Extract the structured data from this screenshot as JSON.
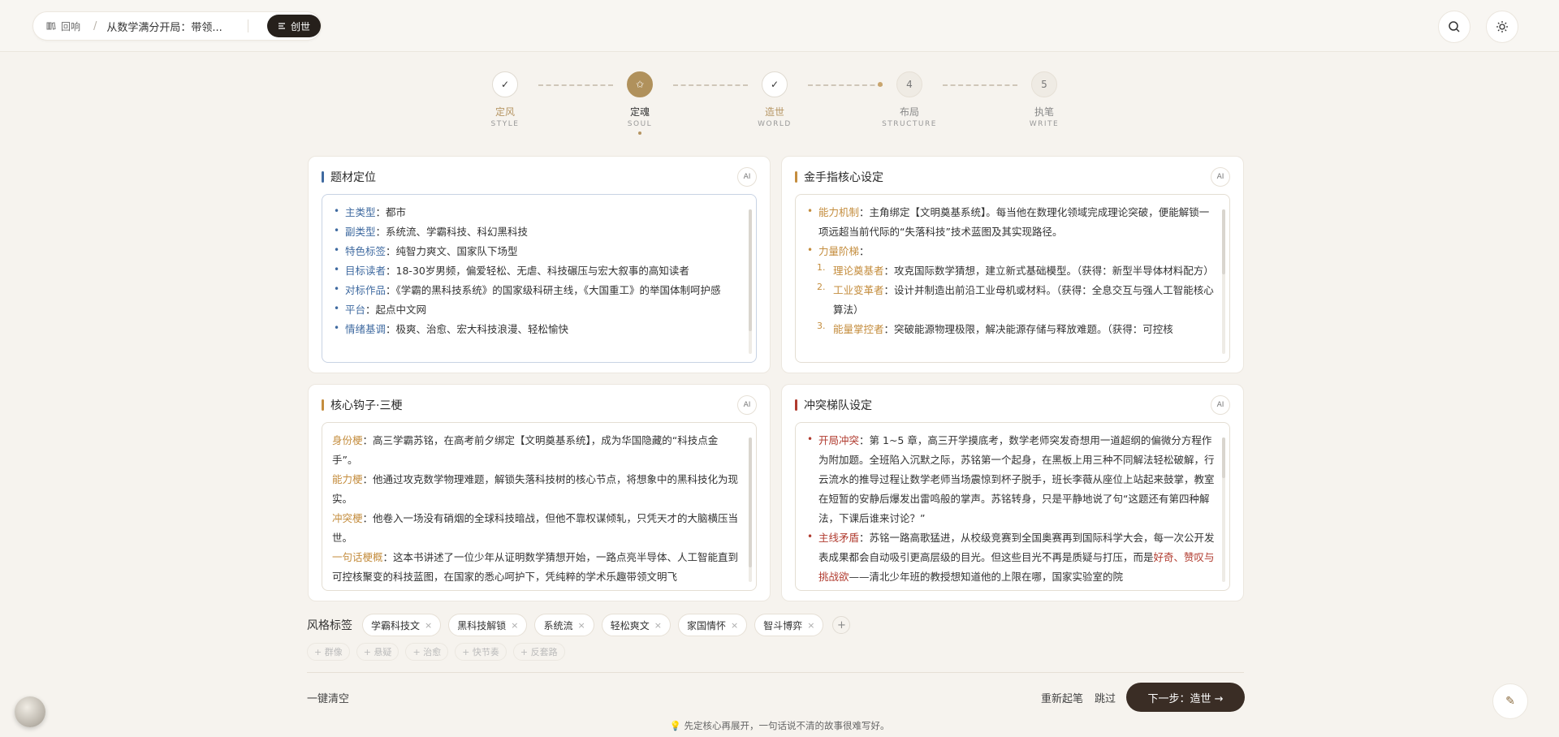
{
  "colors": {
    "accent": "#b0915c",
    "blue_key": "#3f6aa0",
    "orange_key": "#c48d3e",
    "red_key": "#b03a2e",
    "dark": "#26201b"
  },
  "header": {
    "back_label": "回响",
    "separator": "/",
    "doc_title": "从数学满分开局：带领...",
    "create_label": "创世",
    "search_icon": "search-icon",
    "theme_icon": "sun-icon"
  },
  "steps": [
    {
      "zh": "定风",
      "en": "STYLE",
      "state": "done",
      "icon": "check-icon"
    },
    {
      "zh": "定魂",
      "en": "SOUL",
      "state": "active",
      "icon": "star-icon"
    },
    {
      "zh": "造世",
      "en": "WORLD",
      "state": "done",
      "icon": "check-icon"
    },
    {
      "zh": "布局",
      "en": "STRUCTURE",
      "state": "todo",
      "num": "4"
    },
    {
      "zh": "执笔",
      "en": "WRITE",
      "state": "todo",
      "num": "5"
    }
  ],
  "ai_label": "AI",
  "cards": {
    "genre": {
      "title": "题材定位",
      "items": [
        {
          "k": "主类型",
          "sep": "：",
          "v": "都市"
        },
        {
          "k": "副类型",
          "sep": "：",
          "v": "系统流、学霸科技、科幻黑科技"
        },
        {
          "k": "特色标签",
          "sep": "：",
          "v": "纯智力爽文、国家队下场型"
        },
        {
          "k": "目标读者",
          "sep": "：",
          "v": "18-30岁男频，偏爱轻松、无虐、科技碾压与宏大叙事的高知读者"
        },
        {
          "k": "对标作品",
          "sep": "：",
          "v": "《学霸的黑科技系统》的国家级科研主线，《大国重工》的举国体制呵护感"
        },
        {
          "k": "平台",
          "sep": "：",
          "v": "起点中文网"
        },
        {
          "k": "情绪基调",
          "sep": "：",
          "v": "极爽、治愈、宏大科技浪漫、轻松愉快"
        }
      ]
    },
    "goldfinger": {
      "title": "金手指核心设定",
      "mech_k": "能力机制",
      "mech_v": "：主角绑定【文明奠基系统】。每当他在数理化领域完成理论突破，便能解锁一项远超当前代际的“失落科技”技术蓝图及其实现路径。",
      "ladder_k": "力量阶梯",
      "ladder_sep": "：",
      "levels": [
        {
          "n": "1.",
          "k": "理论奠基者",
          "v": "：攻克国际数学猜想，建立新式基础模型。（获得：新型半导体材料配方）"
        },
        {
          "n": "2.",
          "k": "工业变革者",
          "v": "：设计并制造出前沿工业母机或材料。（获得：全息交互与强人工智能核心算法）"
        },
        {
          "n": "3.",
          "k": "能量掌控者",
          "v": "：突破能源物理极限，解决能源存储与释放难题。（获得：可控核"
        }
      ]
    },
    "hooks": {
      "title": "核心钩子·三梗",
      "items": [
        {
          "k": "身份梗",
          "v": "：高三学霸苏铭，在高考前夕绑定【文明奠基系统】，成为华国隐藏的“科技点金手”。"
        },
        {
          "k": "能力梗",
          "v": "：他通过攻克数学物理难题，解锁失落科技树的核心节点，将想象中的黑科技化为现实。"
        },
        {
          "k": "冲突梗",
          "v": "：他卷入一场没有硝烟的全球科技暗战，但他不靠权谋倾轧，只凭天才的大脑横压当世。"
        },
        {
          "k": "一句话梗概",
          "v": "：这本书讲述了一位少年从证明数学猜想开始，一路点亮半导体、人工智能直到可控核聚变的科技蓝图，在国家的悉心呵护下，凭纯粹的学术乐趣带领文明飞"
        }
      ]
    },
    "conflict": {
      "title": "冲突梯队设定",
      "items": [
        {
          "k": "开局冲突",
          "v": "：第 1~5 章，高三开学摸底考，数学老师突发奇想用一道超纲的偏微分方程作为附加题。全班陷入沉默之际，苏铭第一个起身，在黑板上用三种不同解法轻松破解，行云流水的推导过程让数学老师当场震惊到杯子脱手，班长李薇从座位上站起来鼓掌，教室在短暂的安静后爆发出雷鸣般的掌声。苏铭转身，只是平静地说了句“这题还有第四种解法，下课后谁来讨论？”"
        },
        {
          "k": "主线矛盾",
          "v": "：苏铭一路高歌猛进，从校级竞赛到全国奥赛再到国际科学大会，每一次公开发表成果都会自动吸引更高层级的目光。但这些目光不再是质疑与打压，而是",
          "v_red": "好奇、赞叹与挑战欲",
          "v2": "——清北少年班的教授想知道他的上限在哪，国家实验室的院"
        }
      ]
    }
  },
  "style_tags": {
    "label": "风格标签",
    "tags": [
      "学霸科技文",
      "黑科技解锁",
      "系统流",
      "轻松爽文",
      "家国情怀",
      "智斗博弈"
    ],
    "remove": "×",
    "add": "+",
    "suggestions": [
      "+ 群像",
      "+ 悬疑",
      "+ 治愈",
      "+ 快节奏",
      "+ 反套路"
    ]
  },
  "footer": {
    "clear": "一键清空",
    "redo": "重新起笔",
    "skip": "跳过",
    "next": "下一步：造世 →",
    "tip": "💡 先定核心再展开，一句话说不清的故事很难写好。"
  }
}
